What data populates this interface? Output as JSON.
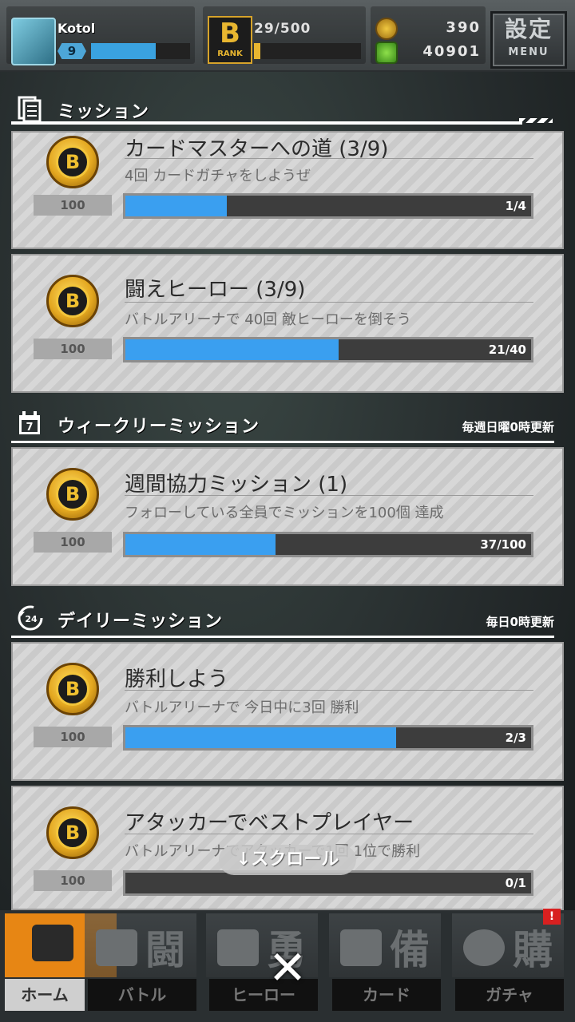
{
  "header": {
    "username": "Kotol",
    "level": "9",
    "rank_label": "RANK",
    "rank_exp": "29/500",
    "coins": "390",
    "gems": "40901",
    "menu_kanji": "設定",
    "menu_label": "MENU"
  },
  "sections": {
    "missions": {
      "title": "ミッション"
    },
    "weekly": {
      "title": "ウィークリーミッション",
      "update_note": "毎週日曜0時更新",
      "icon_number": "7"
    },
    "daily": {
      "title": "デイリーミッション",
      "update_note": "毎日0時更新",
      "icon_number": "24"
    }
  },
  "missions": [
    {
      "title": "カードマスターへの道 (3/9)",
      "description": "4回 カードガチャをしようぜ",
      "reward": "100",
      "progress_text": "1/4",
      "progress": 0.25
    },
    {
      "title": "闘えヒーロー (3/9)",
      "description": "バトルアリーナで 40回 敵ヒーローを倒そう",
      "reward": "100",
      "progress_text": "21/40",
      "progress": 0.525
    },
    {
      "title": "週間協力ミッション (1)",
      "description": "フォローしている全員でミッションを100個 達成",
      "reward": "100",
      "progress_text": "37/100",
      "progress": 0.37
    },
    {
      "title": "勝利しよう",
      "description": "バトルアリーナで 今日中に3回 勝利",
      "reward": "100",
      "progress_text": "2/3",
      "progress": 0.667
    },
    {
      "title": "アタッカーでベストプレイヤー",
      "description": "バトルアリーナでアタッカーで1回 1位で勝利",
      "reward": "100",
      "progress_text": "0/1",
      "progress": 0
    }
  ],
  "scroll_hint": "↓スクロール",
  "nav": {
    "home": "ホーム",
    "battle": "バトル",
    "battle_glyph": "闘",
    "hero": "ヒーロー",
    "hero_glyph": "勇",
    "card": "カード",
    "card_glyph": "備",
    "gacha": "ガチャ",
    "gacha_glyph": "購",
    "badge": "!"
  },
  "close_label": "✕"
}
